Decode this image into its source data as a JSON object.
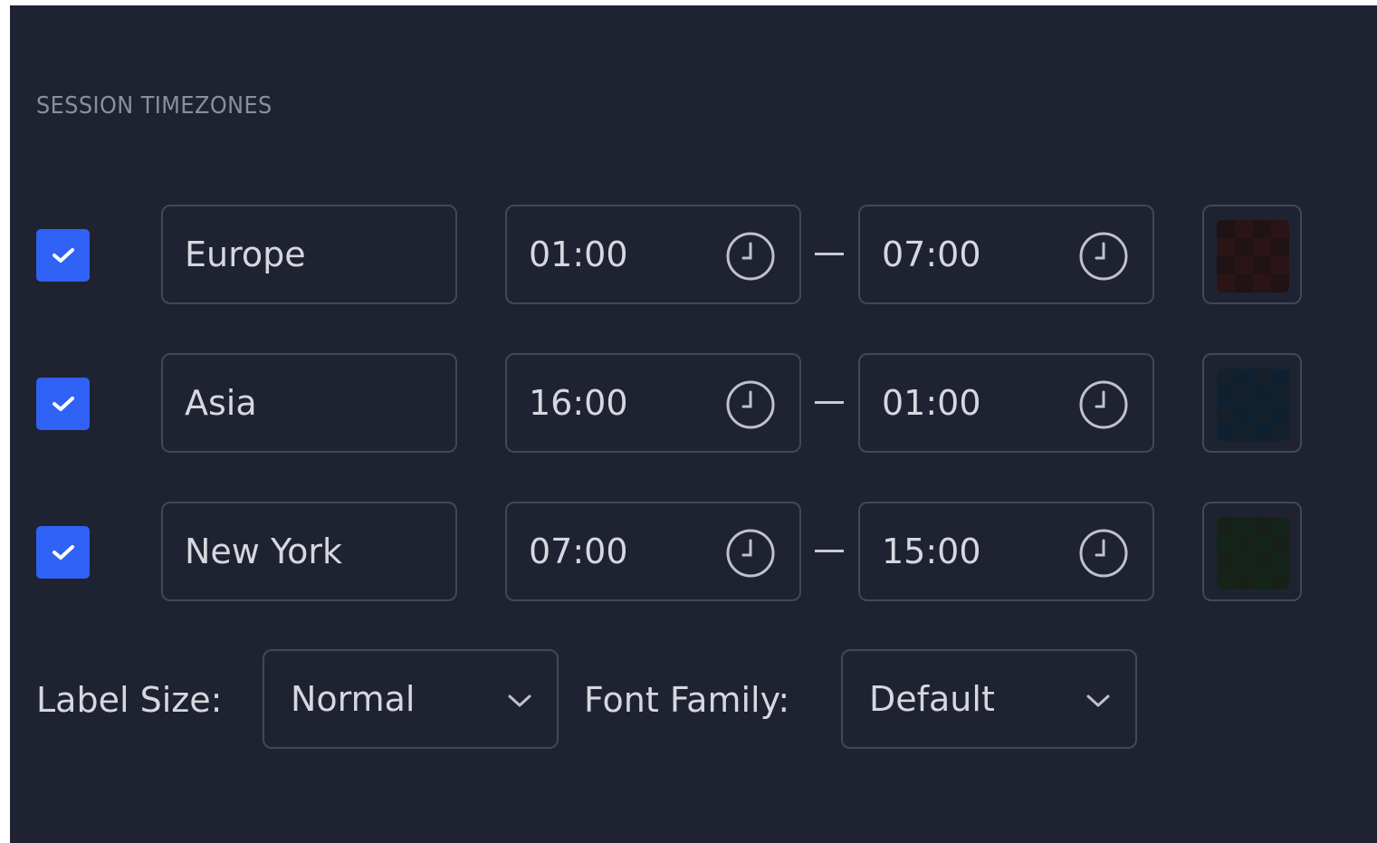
{
  "section": {
    "title": "SESSION TIMEZONES"
  },
  "sessions": [
    {
      "checked": true,
      "name": "Europe",
      "start": "01:00",
      "end": "07:00",
      "color": "#2a1416",
      "color_alt": "#1f1315"
    },
    {
      "checked": true,
      "name": "Asia",
      "start": "16:00",
      "end": "01:00",
      "color": "#0f2130",
      "color_alt": "#14202c"
    },
    {
      "checked": true,
      "name": "New York",
      "start": "07:00",
      "end": "15:00",
      "color": "#142418",
      "color_alt": "#172119"
    }
  ],
  "controls": {
    "label_size_label": "Label Size:",
    "label_size_value": "Normal",
    "font_family_label": "Font Family:",
    "font_family_value": "Default"
  },
  "icons": {
    "checkbox": "check-icon",
    "time": "clock-icon",
    "dropdown": "chevron-down-icon"
  },
  "colors": {
    "panel_bg": "#1f2230",
    "accent": "#2f62f5",
    "border": "#43475a",
    "text": "#d5d8de",
    "muted": "#8b8f9c"
  }
}
